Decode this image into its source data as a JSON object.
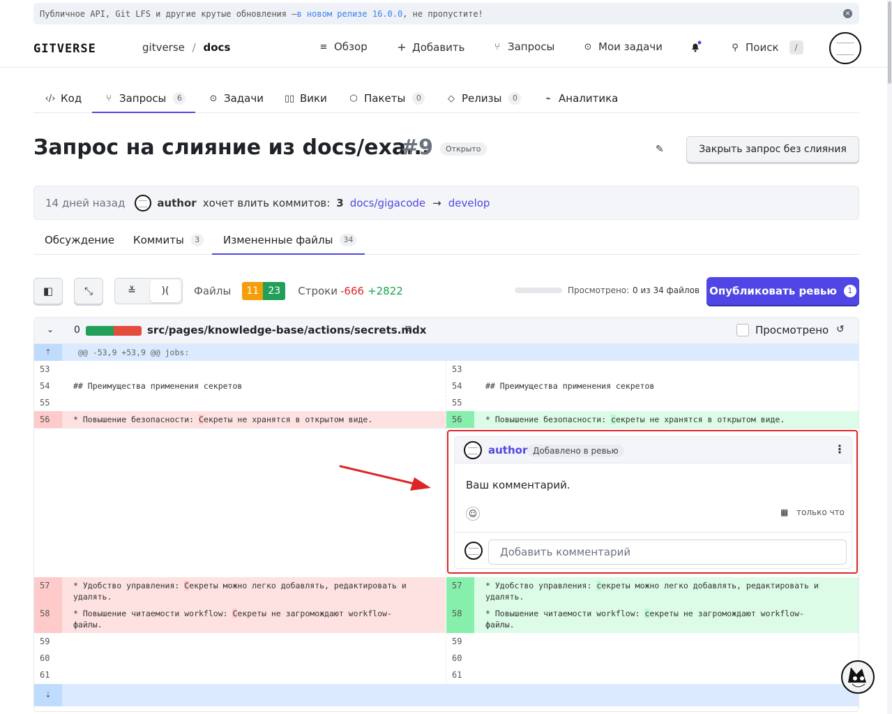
{
  "banner": {
    "text_before": "Публичное API, Git LFS и другие крутые обновления — ",
    "link": "в новом релизе 16.0.0",
    "text_after": ", не пропустите!"
  },
  "header": {
    "logo": "GITVERSE",
    "breadcrumb": {
      "owner": "gitverse",
      "sep": "/",
      "repo": "docs"
    },
    "nav": [
      {
        "label": "Обзор",
        "icon": "overview-icon"
      },
      {
        "label": "Добавить",
        "icon": "plus-icon"
      },
      {
        "label": "Запросы",
        "icon": "pull-request-icon"
      },
      {
        "label": "Мои задачи",
        "icon": "issue-icon"
      }
    ],
    "search": {
      "label": "Поиск",
      "shortcut": "/"
    }
  },
  "repo_tabs": [
    {
      "label": "Код",
      "icon": "code-icon"
    },
    {
      "label": "Запросы",
      "count": "6",
      "icon": "pull-request-icon"
    },
    {
      "label": "Задачи",
      "icon": "issue-icon"
    },
    {
      "label": "Вики",
      "icon": "book-icon"
    },
    {
      "label": "Пакеты",
      "count": "0",
      "icon": "package-icon"
    },
    {
      "label": "Релизы",
      "count": "0",
      "icon": "tag-icon"
    },
    {
      "label": "Аналитика",
      "icon": "chart-icon"
    }
  ],
  "pr": {
    "title": "Запрос на слияние из docs/exa...",
    "number": "#9",
    "state": "Открыто",
    "close_button": "Закрыть запрос без слияния",
    "info": {
      "time": "14 дней назад",
      "author": "author",
      "text": "хочет влить коммитов:",
      "commits": "3",
      "from": "docs/gigacode",
      "arrow": "→",
      "to": "develop"
    }
  },
  "sub_tabs": [
    {
      "label": "Обсуждение"
    },
    {
      "label": "Коммиты",
      "count": "3"
    },
    {
      "label": "Измененные файлы",
      "count": "34"
    }
  ],
  "toolbar": {
    "files_label": "Файлы",
    "files_changed": "11",
    "files_added": "23",
    "lines_label": "Строки",
    "lines_removed": "-666",
    "lines_added": "+2822",
    "viewed_label": "Просмотрено:",
    "viewed_value": "0 из 34 файлов",
    "publish_label": "Опубликовать ревью",
    "publish_count": "1"
  },
  "file": {
    "count": "0",
    "path": "src/pages/knowledge-base/actions/secrets.mdx",
    "viewed_label": "Просмотрено",
    "hunk": "@@ -53,9 +53,9 @@ jobs:",
    "left": [
      {
        "n": "53",
        "t": ""
      },
      {
        "n": "54",
        "t": "## Преимущества применения секретов"
      },
      {
        "n": "55",
        "t": ""
      }
    ],
    "del56": {
      "n": "56",
      "pre": "* Повышение безопасности: ",
      "hl": "С",
      "post": "екреты не хранятся в открытом виде."
    },
    "add56": {
      "n": "56",
      "pre": "* Повышение безопасности: ",
      "hl": "с",
      "post": "екреты не хранятся в открытом виде."
    },
    "del57": {
      "n": "57",
      "pre": "* Удобство управления: ",
      "hl": "С",
      "post": "екреты можно легко добавлять, редактировать и",
      "line2": "удалять."
    },
    "add57": {
      "n": "57",
      "pre": "* Удобство управления: ",
      "hl": "с",
      "post": "екреты можно легко добавлять, редактировать и",
      "line2": "удалять."
    },
    "del58": {
      "n": "58",
      "pre": "* Повышение читаемости workflow: ",
      "hl": "С",
      "post": "екреты не загромождают workflow-",
      "line2": "файлы."
    },
    "add58": {
      "n": "58",
      "pre": "* Повышение читаемости workflow: ",
      "hl": "с",
      "post": "екреты не загромождают workflow-",
      "line2": "файлы."
    },
    "tail": [
      "59",
      "60",
      "61"
    ]
  },
  "comment": {
    "author": "author",
    "badge": "Добавлено в ревью",
    "body": "Ваш комментарий.",
    "time": "только что",
    "add_placeholder": "Добавить комментарий"
  },
  "colors": {
    "accent": "#4f46e5",
    "annotation": "#dc2626"
  }
}
